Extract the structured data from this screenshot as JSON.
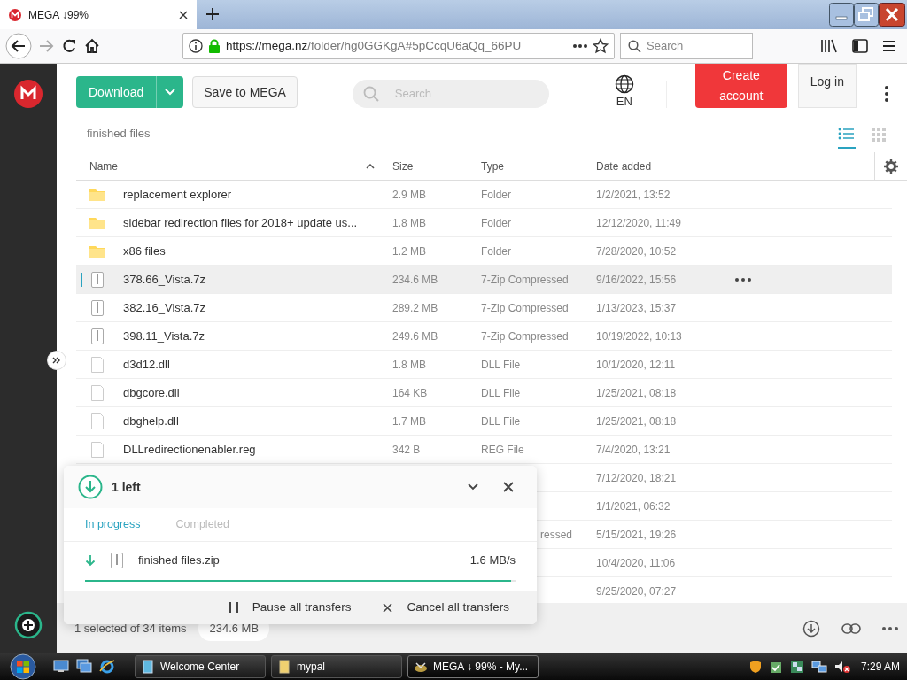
{
  "browser": {
    "tab_title": "MEGA ↓99%",
    "url_host": "https://mega.nz",
    "url_path": "/folder/hg0GGKgA#5pCcqU6aQq_66PU",
    "search_placeholder": "Search"
  },
  "header": {
    "download": "Download",
    "save": "Save to MEGA",
    "search_placeholder": "Search",
    "language": "EN",
    "create_account": "Create account",
    "login": "Log in"
  },
  "breadcrumb": "finished files",
  "views": [
    {
      "kind": "list",
      "selected": true
    },
    {
      "kind": "grid",
      "selected": false
    }
  ],
  "table": {
    "columns": [
      "Name",
      "Size",
      "Type",
      "Date added"
    ],
    "rows": [
      {
        "kind": "folder",
        "name": "replacement explorer",
        "size": "2.9 MB",
        "type": "Folder",
        "date": "1/2/2021, 13:52",
        "selected": false
      },
      {
        "kind": "folder",
        "name": "sidebar redirection files for 2018+ update us...",
        "size": "1.8 MB",
        "type": "Folder",
        "date": "12/12/2020, 11:49",
        "selected": false
      },
      {
        "kind": "folder",
        "name": "x86 files",
        "size": "1.2 MB",
        "type": "Folder",
        "date": "7/28/2020, 10:52",
        "selected": false
      },
      {
        "kind": "archive",
        "name": "378.66_Vista.7z",
        "size": "234.6 MB",
        "type": "7-Zip Compressed",
        "date": "9/16/2022, 15:56",
        "selected": true
      },
      {
        "kind": "archive",
        "name": "382.16_Vista.7z",
        "size": "289.2 MB",
        "type": "7-Zip Compressed",
        "date": "1/13/2023, 15:37",
        "selected": false
      },
      {
        "kind": "archive",
        "name": "398.11_Vista.7z",
        "size": "249.6 MB",
        "type": "7-Zip Compressed",
        "date": "10/19/2022, 10:13",
        "selected": false
      },
      {
        "kind": "file",
        "name": "d3d12.dll",
        "size": "1.8 MB",
        "type": "DLL File",
        "date": "10/1/2020, 12:11",
        "selected": false
      },
      {
        "kind": "file",
        "name": "dbgcore.dll",
        "size": "164 KB",
        "type": "DLL File",
        "date": "1/25/2021, 08:18",
        "selected": false
      },
      {
        "kind": "file",
        "name": "dbghelp.dll",
        "size": "1.7 MB",
        "type": "DLL File",
        "date": "1/25/2021, 08:18",
        "selected": false
      },
      {
        "kind": "file",
        "name": "DLLredirectionenabler.reg",
        "size": "342 B",
        "type": "REG File",
        "date": "7/4/2020, 13:21",
        "selected": false
      },
      {
        "kind": "hidden",
        "date": "7/12/2020, 18:21",
        "selected": false
      },
      {
        "kind": "hidden",
        "date": "1/1/2021, 06:32",
        "selected": false
      },
      {
        "kind": "hidden",
        "type_tail": "ressed",
        "date": "5/15/2021, 19:26",
        "selected": false
      },
      {
        "kind": "hidden",
        "date": "10/4/2020, 11:06",
        "selected": false
      },
      {
        "kind": "hidden",
        "date": "9/25/2020, 07:27",
        "selected": false
      }
    ]
  },
  "status": {
    "selection": "1 selected of 34 items",
    "size": "234.6 MB"
  },
  "transfers": {
    "title": "1 left",
    "tabs": [
      {
        "label": "In progress",
        "selected": true
      },
      {
        "label": "Completed",
        "selected": false
      }
    ],
    "items": [
      {
        "name": "finished files.zip",
        "speed": "1.6 MB/s",
        "level": 0.99
      }
    ],
    "actions": [
      {
        "kind": "pause",
        "label": "Pause all transfers"
      },
      {
        "kind": "cancel",
        "label": "Cancel all transfers"
      }
    ]
  },
  "taskbar": {
    "items": [
      {
        "label": "Welcome Center",
        "active": false
      },
      {
        "label": "mypal",
        "active": false
      },
      {
        "label": "MEGA ↓ 99% - My...",
        "active": true
      }
    ],
    "clock": "7:29 AM"
  }
}
